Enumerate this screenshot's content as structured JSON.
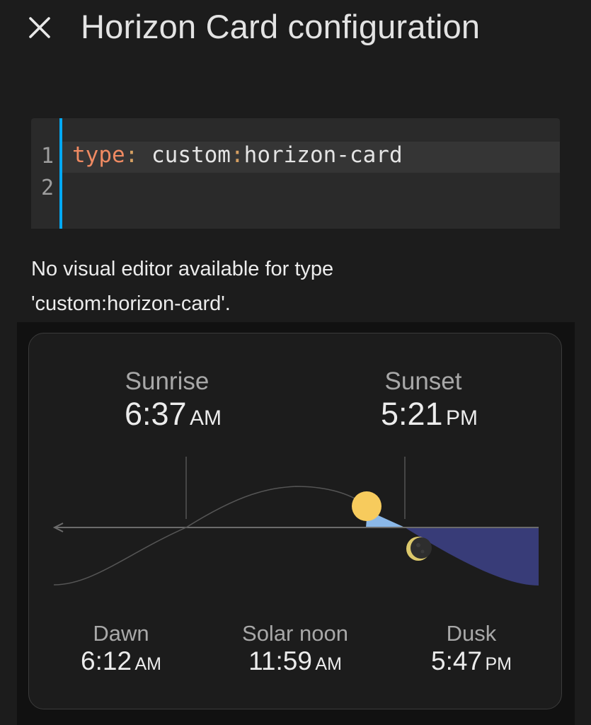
{
  "header": {
    "title": "Horizon Card configuration",
    "close_icon": "close-icon"
  },
  "editor": {
    "line_numbers": [
      "1",
      "2"
    ],
    "line1": {
      "key": "type",
      "colon": ":",
      "value_pre": " custom",
      "value_colon": ":",
      "value_post": "horizon-card"
    },
    "accent_color": "#03a9f4"
  },
  "notice": {
    "line1": "No visual editor available for type",
    "line2": "'custom:horizon-card'."
  },
  "card": {
    "sunrise": {
      "label": "Sunrise",
      "time": "6:37",
      "ampm": "AM"
    },
    "sunset": {
      "label": "Sunset",
      "time": "5:21",
      "ampm": "PM"
    },
    "dawn": {
      "label": "Dawn",
      "time": "6:12",
      "ampm": "AM"
    },
    "solar_noon": {
      "label": "Solar noon",
      "time": "11:59",
      "ampm": "AM"
    },
    "dusk": {
      "label": "Dusk",
      "time": "5:47",
      "ampm": "PM"
    },
    "colors": {
      "sun": "#f7cb5d",
      "twilight": "#8bb8e8",
      "night": "#383c78",
      "moon": "#dcc86b"
    }
  }
}
